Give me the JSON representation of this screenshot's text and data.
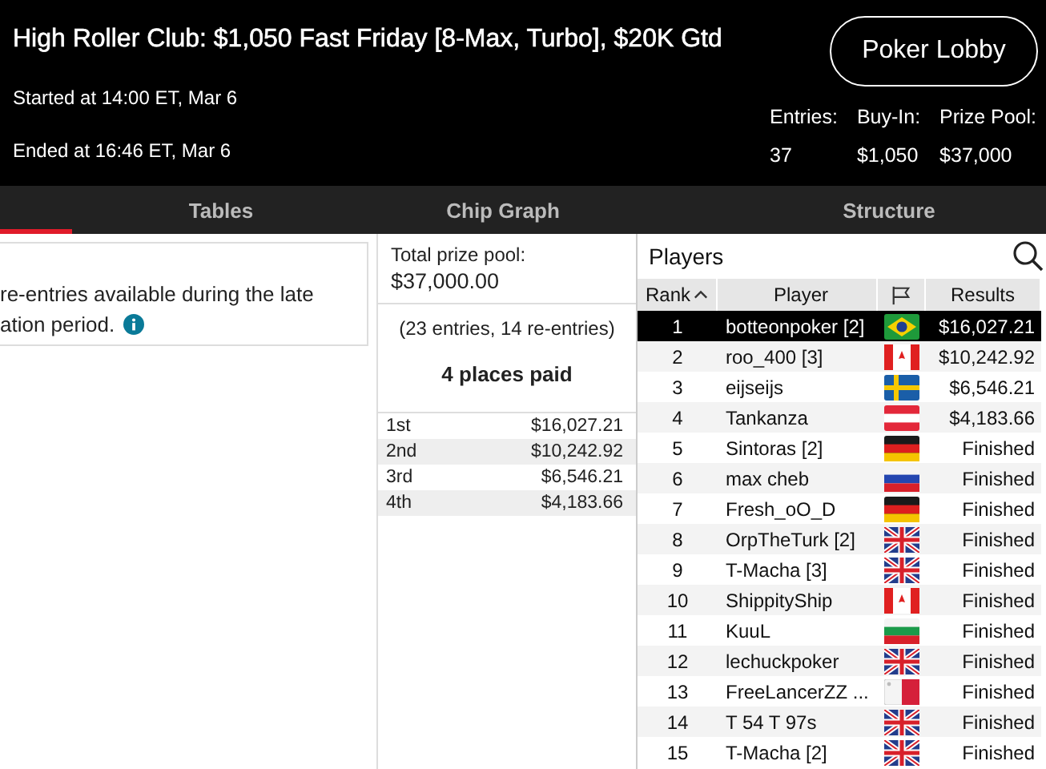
{
  "header": {
    "title": "High Roller Club: $1,050 Fast Friday [8-Max, Turbo], $20K Gtd",
    "lobby_button": "Poker Lobby",
    "started": "Started at 14:00 ET, Mar 6",
    "ended": "Ended at 16:46 ET, Mar 6",
    "stats": [
      {
        "label": "Entries:",
        "value": "37"
      },
      {
        "label": "Buy-In:",
        "value": "$1,050"
      },
      {
        "label": "Prize Pool:",
        "value": "$37,000"
      }
    ]
  },
  "tabs": [
    {
      "label": "Tables",
      "selected": false
    },
    {
      "label": "Chip Graph",
      "selected": false
    },
    {
      "label": "Structure",
      "selected": false
    }
  ],
  "info_box": {
    "lines": [
      "re-entries available during the late",
      "ation period."
    ]
  },
  "prize_panel": {
    "total_label": "Total prize pool:",
    "total": "$37,000.00",
    "entries_note": "(23 entries, 14 re-entries)",
    "places_paid": "4 places paid",
    "payouts": [
      {
        "place": "1st",
        "amount": "$16,027.21"
      },
      {
        "place": "2nd",
        "amount": "$10,242.92"
      },
      {
        "place": "3rd",
        "amount": "$6,546.21"
      },
      {
        "place": "4th",
        "amount": "$4,183.66"
      }
    ]
  },
  "players": {
    "title": "Players",
    "columns": [
      "Rank",
      "Player",
      "Results"
    ],
    "rows": [
      {
        "rank": "1",
        "player": "botteonpoker [2]",
        "kind": "br",
        "result": "$16,027.21",
        "selected": true
      },
      {
        "rank": "2",
        "player": "roo_400 [3]",
        "kind": "ca",
        "result": "$10,242.92",
        "selected": false
      },
      {
        "rank": "3",
        "player": "eijseijs",
        "kind": "se",
        "result": "$6,546.21",
        "selected": false
      },
      {
        "rank": "4",
        "player": "Tankanza",
        "kind": "at",
        "result": "$4,183.66",
        "selected": false
      },
      {
        "rank": "5",
        "player": "Sintoras [2]",
        "kind": "de",
        "result": "Finished",
        "selected": false
      },
      {
        "rank": "6",
        "player": "max cheb",
        "kind": "ru",
        "result": "Finished",
        "selected": false
      },
      {
        "rank": "7",
        "player": "Fresh_oO_D",
        "kind": "de",
        "result": "Finished",
        "selected": false
      },
      {
        "rank": "8",
        "player": "OrpTheTurk [2]",
        "kind": "gb",
        "result": "Finished",
        "selected": false
      },
      {
        "rank": "9",
        "player": "T-Macha [3]",
        "kind": "gb",
        "result": "Finished",
        "selected": false
      },
      {
        "rank": "10",
        "player": "ShippityShip",
        "kind": "ca",
        "result": "Finished",
        "selected": false
      },
      {
        "rank": "11",
        "player": "KuuL",
        "kind": "bg",
        "result": "Finished",
        "selected": false
      },
      {
        "rank": "12",
        "player": "lechuckpoker",
        "kind": "gb",
        "result": "Finished",
        "selected": false
      },
      {
        "rank": "13",
        "player": "FreeLancerZZ ...",
        "kind": "mt",
        "result": "Finished",
        "selected": false
      },
      {
        "rank": "14",
        "player": "T 54 T 97s",
        "kind": "gb",
        "result": "Finished",
        "selected": false
      },
      {
        "rank": "15",
        "player": "T-Macha [2]",
        "kind": "gb",
        "result": "Finished",
        "selected": false
      }
    ]
  }
}
